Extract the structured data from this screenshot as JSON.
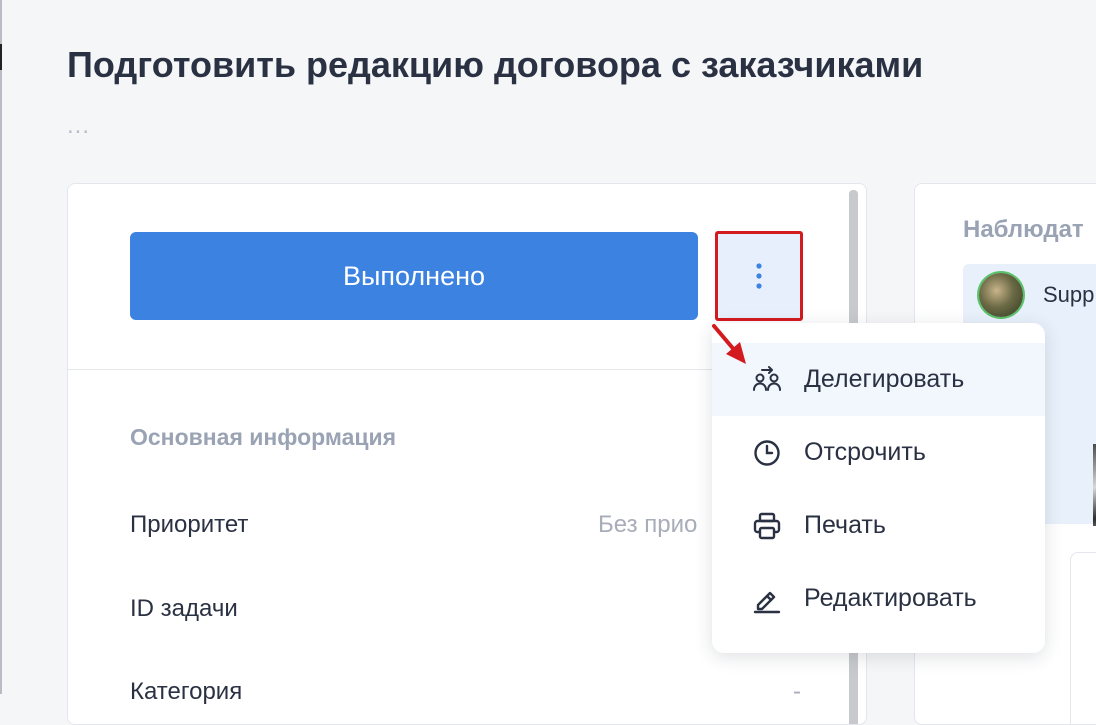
{
  "task": {
    "title": "Подготовить редакцию договора с заказчиками",
    "subtitle": "..."
  },
  "actions": {
    "done_label": "Выполнено",
    "more_icon": "kebab-vertical-icon"
  },
  "info": {
    "section_title": "Основная информация",
    "fields": [
      {
        "label": "Приоритет",
        "value": "Без прио"
      },
      {
        "label": "ID задачи",
        "value": ""
      },
      {
        "label": "Категория",
        "value": "-"
      }
    ]
  },
  "observers": {
    "title": "Наблюдат",
    "items": [
      {
        "name": "Supp"
      }
    ]
  },
  "menu": {
    "items": [
      {
        "label": "Делегировать",
        "icon": "delegate-icon"
      },
      {
        "label": "Отсрочить",
        "icon": "clock-icon"
      },
      {
        "label": "Печать",
        "icon": "printer-icon"
      },
      {
        "label": "Редактировать",
        "icon": "pencil-icon"
      }
    ]
  },
  "colors": {
    "primary": "#3c82e0",
    "highlight_border": "#d31a1f",
    "annotation_arrow": "#d31a1f"
  }
}
